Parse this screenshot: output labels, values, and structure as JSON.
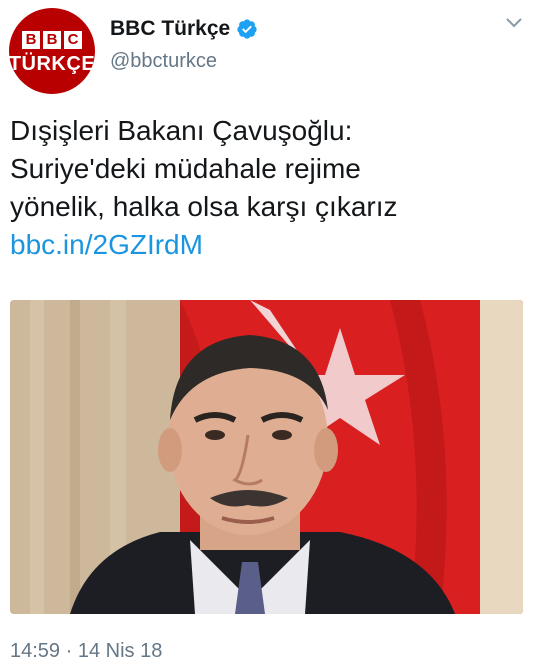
{
  "account": {
    "avatar_logo_letters": [
      "B",
      "B",
      "C"
    ],
    "avatar_logo_sub": "TÜRKÇE",
    "display_name": "BBC Türkçe",
    "handle": "@bbcturkce",
    "verified": true,
    "avatar_color": "#b80000"
  },
  "tweet": {
    "text_lines": [
      "Dışişleri Bakanı Çavuşoğlu:",
      "Suriye'deki müdahale rejime",
      "yönelik, halka olsa karşı çıkarız"
    ],
    "link": "bbc.in/2GZIrdM",
    "link_color": "#1b95e0"
  },
  "timestamp": "14:59 · 14 Nis 18",
  "icons": {
    "verified": "verified-badge-icon",
    "menu": "chevron-down-icon"
  }
}
